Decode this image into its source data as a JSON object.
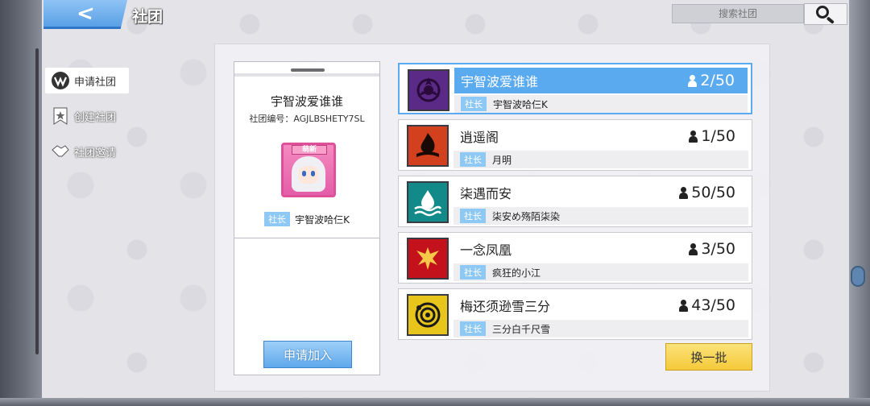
{
  "header": {
    "title": "社团",
    "back_icon": "chevron-left-icon",
    "search_placeholder": "搜索社团",
    "search_icon": "search-icon"
  },
  "sidebar": {
    "items": [
      {
        "label": "申请社团",
        "icon": "apply-club-icon",
        "active": true
      },
      {
        "label": "创建社团",
        "icon": "create-club-icon",
        "active": false
      },
      {
        "label": "社团邀请",
        "icon": "invite-handshake-icon",
        "active": false
      }
    ]
  },
  "detail": {
    "name": "宇智波爱谁谁",
    "code": "社团编号：AGJLBSHETY7SL",
    "avatar_badge": "萌新",
    "leader_tag": "社长",
    "leader_name": "宇智波哈仨K",
    "apply_label": "申请加入"
  },
  "clubs": [
    {
      "name": "宇智波爱谁谁",
      "members": "2/50",
      "leader_tag": "社长",
      "leader": "宇智波哈仨K",
      "selected": true,
      "emblem": "sharingan-emblem-icon",
      "emblem_color": "#5b2a86"
    },
    {
      "name": "逍遥阁",
      "members": "1/50",
      "leader_tag": "社长",
      "leader": "月明",
      "selected": false,
      "emblem": "flame-emblem-icon",
      "emblem_color": "#d2401e"
    },
    {
      "name": "柒遇而安",
      "members": "50/50",
      "leader_tag": "社长",
      "leader": "柒安め殇陌柒染",
      "selected": false,
      "emblem": "water-emblem-icon",
      "emblem_color": "#138a8a"
    },
    {
      "name": "一念凤凰",
      "members": "3/50",
      "leader_tag": "社长",
      "leader": "疯狂的小江",
      "selected": false,
      "emblem": "phoenix-emblem-icon",
      "emblem_color": "#c4121c"
    },
    {
      "name": "梅还须逊雪三分",
      "members": "43/50",
      "leader_tag": "社长",
      "leader": "三分白千尺雪",
      "selected": false,
      "emblem": "orbit-emblem-icon",
      "emblem_color": "#e8c51a"
    }
  ],
  "refresh_label": "换一批",
  "colors": {
    "accent_blue": "#5aaaf0",
    "refresh_yellow": "#f5c93a"
  }
}
